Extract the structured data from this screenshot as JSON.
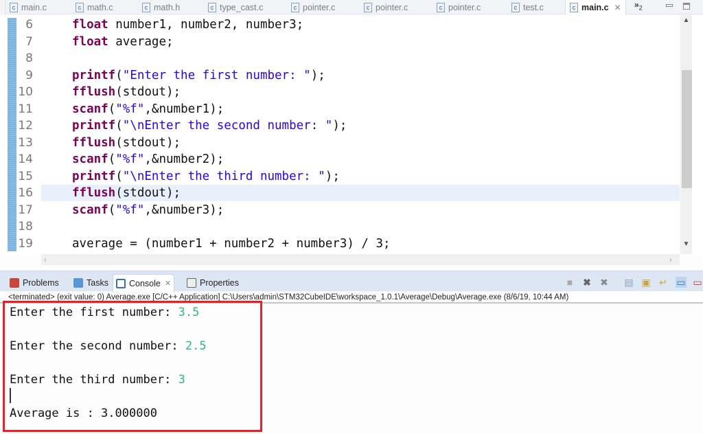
{
  "editor_tabs": [
    {
      "label": "main.c",
      "icon": "c-file-icon",
      "active": false
    },
    {
      "label": "math.c",
      "icon": "c-file-icon",
      "active": false
    },
    {
      "label": "math.h",
      "icon": "h-file-icon",
      "active": false
    },
    {
      "label": "type_cast.c",
      "icon": "c-file-icon",
      "active": false
    },
    {
      "label": "pointer.c",
      "icon": "c-file-icon",
      "active": false
    },
    {
      "label": "pointer.c",
      "icon": "c-file-icon",
      "active": false
    },
    {
      "label": "pointer.c",
      "icon": "c-file-icon",
      "active": false
    },
    {
      "label": "test.c",
      "icon": "c-file-icon",
      "active": false
    },
    {
      "label": "main.c",
      "icon": "c-file-icon",
      "active": true
    }
  ],
  "tab_overflow": {
    "symbol": "»",
    "count": "2"
  },
  "close_glyph": "✕",
  "code_lines": [
    {
      "num": "6",
      "text": "float number1, number2, number3;"
    },
    {
      "num": "7",
      "text": "float average;"
    },
    {
      "num": "8",
      "text": ""
    },
    {
      "num": "9",
      "text": "printf(\"Enter the first number: \");"
    },
    {
      "num": "10",
      "text": "fflush(stdout);"
    },
    {
      "num": "11",
      "text": "scanf(\"%f\",&number1);"
    },
    {
      "num": "12",
      "text": "printf(\"\\nEnter the second number: \");"
    },
    {
      "num": "13",
      "text": "fflush(stdout);"
    },
    {
      "num": "14",
      "text": "scanf(\"%f\",&number2);"
    },
    {
      "num": "15",
      "text": "printf(\"\\nEnter the third number: \");"
    },
    {
      "num": "16",
      "text": "fflush(stdout);",
      "current": true
    },
    {
      "num": "17",
      "text": "scanf(\"%f\",&number3);"
    },
    {
      "num": "18",
      "text": ""
    },
    {
      "num": "19",
      "text": "average = (number1 + number2 + number3) / 3;"
    }
  ],
  "view_tabs": [
    {
      "label": "Problems",
      "icon": "problems-icon",
      "active": false
    },
    {
      "label": "Tasks",
      "icon": "tasks-icon",
      "active": false
    },
    {
      "label": "Console",
      "icon": "console-icon",
      "active": true
    },
    {
      "label": "Properties",
      "icon": "properties-icon",
      "active": false
    }
  ],
  "console_status": "<terminated> (exit value: 0) Average.exe [C/C++ Application] C:\\Users\\admin\\STM32CubeIDE\\workspace_1.0.1\\Average\\Debug\\Average.exe (8/6/19, 10:44 AM)",
  "console_output": [
    {
      "prompt": "Enter the first number: ",
      "input": "3.5"
    },
    {
      "prompt": "Enter the second number: ",
      "input": "2.5"
    },
    {
      "prompt": "Enter the third number: ",
      "input": "3"
    },
    {
      "prompt": "Average is : 3.000000",
      "input": ""
    }
  ],
  "colors": {
    "highlight_box": "#e8202c",
    "keyword": "#7f0055",
    "string": "#2a00ff",
    "console_input": "#2fb88a"
  }
}
